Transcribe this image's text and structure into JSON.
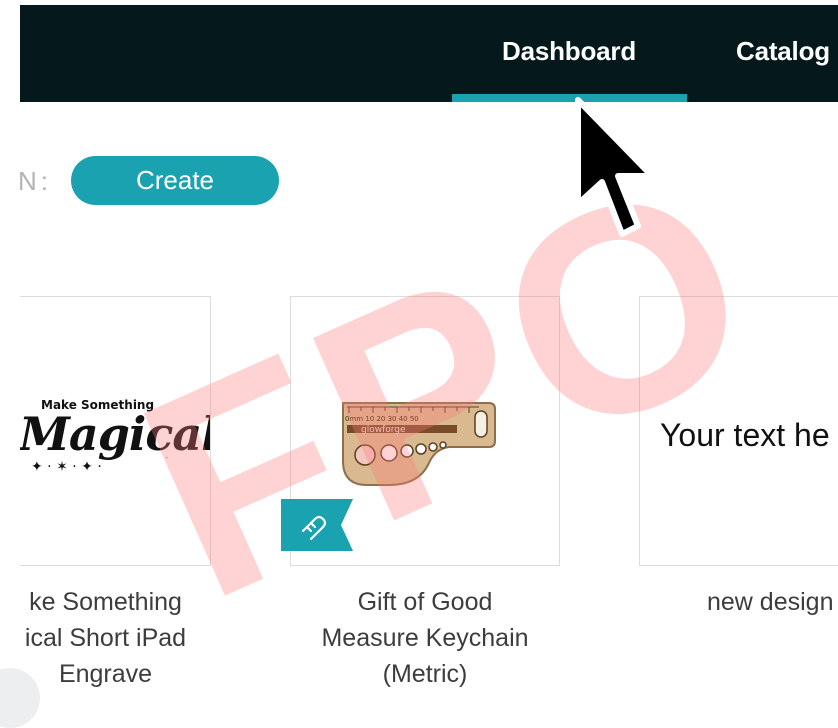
{
  "nav": {
    "items": [
      {
        "label": "Dashboard",
        "active": true
      },
      {
        "label": "Catalog",
        "active": false
      }
    ],
    "accent": "#1aa2b1",
    "background": "#05191d"
  },
  "toolbar": {
    "design_label": "N:",
    "create_label": "Create"
  },
  "designs": [
    {
      "art_small": "Make Something",
      "art_big": "Magical",
      "caption_lines": [
        "ke Something",
        "ical Short iPad",
        "Engrave"
      ]
    },
    {
      "art_text": "glowforge",
      "caption_lines": [
        "Gift of Good",
        "Measure Keychain",
        "(Metric)"
      ],
      "badge_icon": "ruler-ribbon-icon"
    },
    {
      "art_text": "Your text he",
      "caption_lines": [
        "new design"
      ]
    }
  ],
  "watermark": "FPO"
}
